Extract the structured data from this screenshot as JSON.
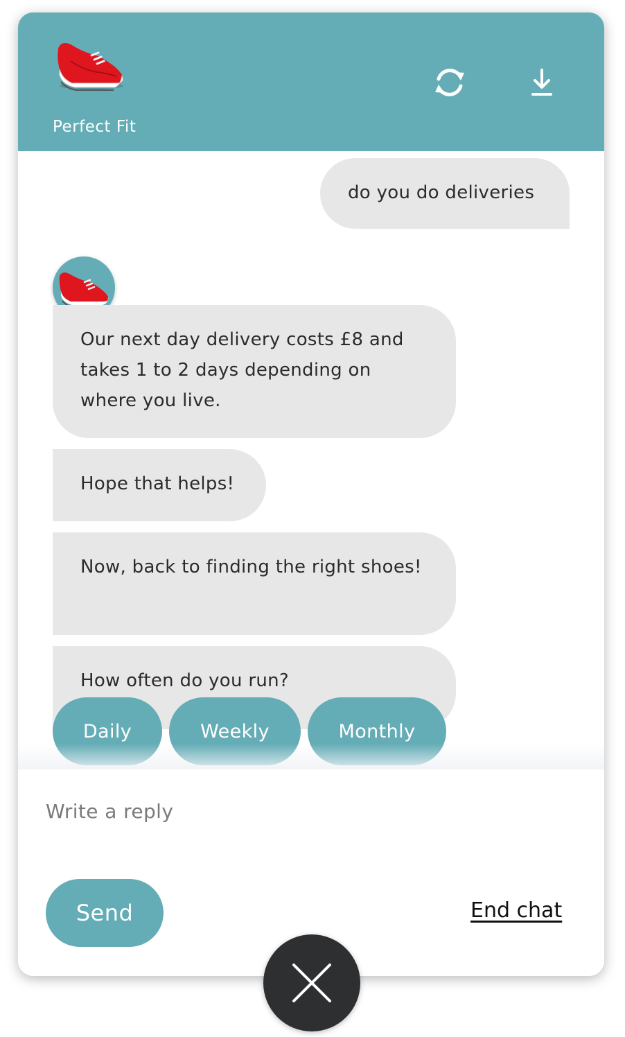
{
  "header": {
    "brand_name": "Perfect Fit",
    "logo_icon": "red-running-shoe",
    "refresh_icon": "refresh-icon",
    "download_icon": "download-icon",
    "accent_color": "#64adb6"
  },
  "messages": {
    "user": [
      "do you do deliveries"
    ],
    "bot": [
      "Our next day delivery costs £8 and takes 1 to 2 days depending on where you live.",
      "Hope that helps!",
      "Now, back to finding the right shoes!",
      "How often do you run?"
    ]
  },
  "quick_replies": [
    "Daily",
    "Weekly",
    "Monthly"
  ],
  "composer": {
    "placeholder": "Write a reply",
    "send_label": "Send",
    "end_chat_label": "End chat"
  },
  "close_icon": "close-icon"
}
